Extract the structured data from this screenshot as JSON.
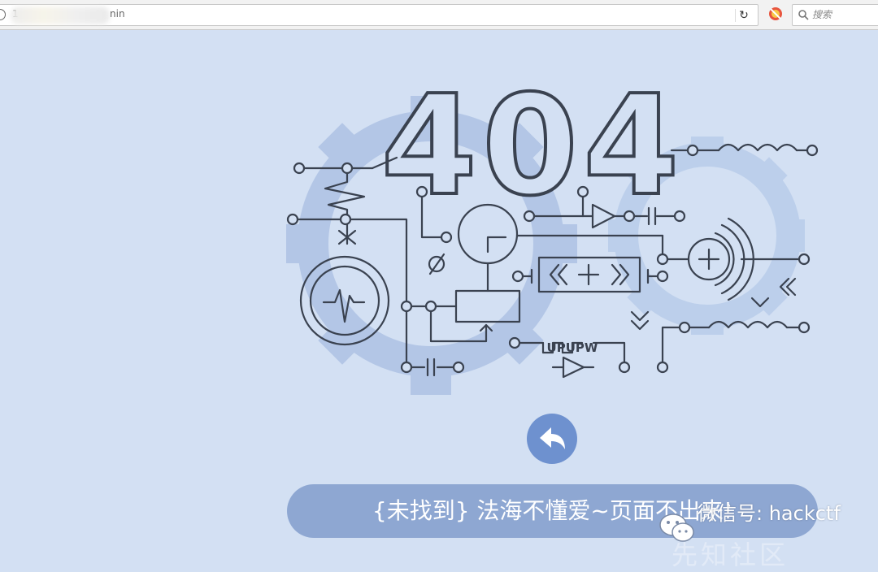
{
  "browser": {
    "url_visible_start": "1",
    "url_visible_end": "nin",
    "search_placeholder": "搜索"
  },
  "page": {
    "error_code": "404",
    "message": "{未找到} 法海不懂爱~页面不出来!",
    "back_icon": "undo-arrow-icon"
  },
  "circuit": {
    "label_upupw": "UPUPW",
    "label_phi": "Ø"
  },
  "watermark": {
    "text": "微信号: hackctf",
    "faded_text": "先知社区"
  },
  "colors": {
    "background": "#d3e0f3",
    "line": "#3a4250",
    "gear": "#b3c6e6",
    "accent": "#6e91cf",
    "message_bar": "#8ea7d2"
  }
}
